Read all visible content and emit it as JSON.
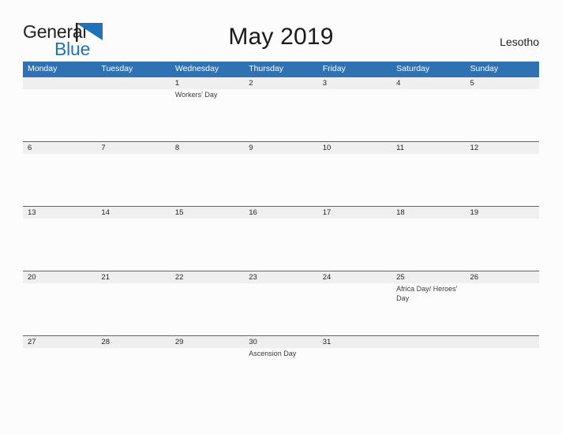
{
  "branding": {
    "logo_primary": "General",
    "logo_secondary": "Blue",
    "flag_color": "#1f73b9"
  },
  "header": {
    "title": "May 2019",
    "country": "Lesotho"
  },
  "theme": {
    "header_blue": "#2e72b3",
    "date_band_gray": "#efefef",
    "page_background": "#fcfcfc",
    "text_color": "#231f20"
  },
  "calendar": {
    "weekday_headers": [
      "Monday",
      "Tuesday",
      "Wednesday",
      "Thursday",
      "Friday",
      "Saturday",
      "Sunday"
    ],
    "weeks": [
      {
        "dates": [
          "",
          "",
          "1",
          "2",
          "3",
          "4",
          "5"
        ],
        "events": [
          "",
          "",
          "Workers' Day",
          "",
          "",
          "",
          ""
        ]
      },
      {
        "dates": [
          "6",
          "7",
          "8",
          "9",
          "10",
          "11",
          "12"
        ],
        "events": [
          "",
          "",
          "",
          "",
          "",
          "",
          ""
        ]
      },
      {
        "dates": [
          "13",
          "14",
          "15",
          "16",
          "17",
          "18",
          "19"
        ],
        "events": [
          "",
          "",
          "",
          "",
          "",
          "",
          ""
        ]
      },
      {
        "dates": [
          "20",
          "21",
          "22",
          "23",
          "24",
          "25",
          "26"
        ],
        "events": [
          "",
          "",
          "",
          "",
          "",
          "Africa Day/ Heroes' Day",
          ""
        ]
      },
      {
        "dates": [
          "27",
          "28",
          "29",
          "30",
          "31",
          "",
          ""
        ],
        "events": [
          "",
          "",
          "",
          "Ascension Day",
          "",
          "",
          ""
        ]
      }
    ]
  }
}
